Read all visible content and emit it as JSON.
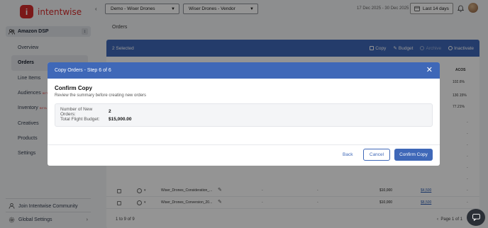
{
  "brand": {
    "name": "intentwise",
    "mark": "i"
  },
  "sidebar": {
    "section": "Amazon DSP",
    "items": [
      {
        "label": "Overview",
        "beta": ""
      },
      {
        "label": "Orders",
        "beta": ""
      },
      {
        "label": "Line Items",
        "beta": ""
      },
      {
        "label": "Audiences",
        "beta": "BETA"
      },
      {
        "label": "Inventory",
        "beta": "BETA"
      },
      {
        "label": "Creatives",
        "beta": ""
      },
      {
        "label": "Products",
        "beta": ""
      },
      {
        "label": "Settings",
        "beta": ""
      }
    ],
    "community": "Join Intentwise Community",
    "global_settings": "Global Settings"
  },
  "topbar": {
    "account_select": "Demo - Wiser Drones",
    "profile_select": "Wiser Drones - Vendor",
    "date_range": "17 Dec 2025 - 30 Dec 2025",
    "period_button": "Last 14 days"
  },
  "main": {
    "title": "Orders",
    "selection_bar": {
      "count": "2 Selected",
      "actions": {
        "copy": "Copy",
        "budget": "Budget",
        "archive": "Archive",
        "inactivate": "Inactivate"
      }
    },
    "table": {
      "acos_header": "ACOS",
      "acos_values": [
        "102.6%",
        "130.15%",
        "77.21%"
      ],
      "rows": [
        {
          "name": "Wiser_Drones_Consideration_...",
          "c1": "-",
          "c2": "-",
          "budget": "$10,000",
          "spend": "$4,500",
          "c5": "-"
        },
        {
          "name": "Wiser_Drones_Conversion_20...",
          "c1": "-",
          "c2": "-",
          "budget": "$10,000",
          "spend": "$8,500",
          "c5": "-"
        }
      ]
    },
    "pager": {
      "range": "1 to 9 of 9",
      "page": "Page 1 of 1"
    }
  },
  "modal": {
    "header": "Copy Orders - Step 6 of 6",
    "title": "Confirm Copy",
    "subtitle": "Review the summary before creating new orders",
    "summary": {
      "orders_label": "Number of New Orders:",
      "orders_value": "2",
      "budget_label": "Total Flight Budget:",
      "budget_value": "$15,000.00"
    },
    "back": "Back",
    "cancel": "Cancel",
    "confirm": "Confirm Copy"
  },
  "colors": {
    "brand_red": "#d52b2b",
    "primary_blue": "#3f68b8"
  }
}
